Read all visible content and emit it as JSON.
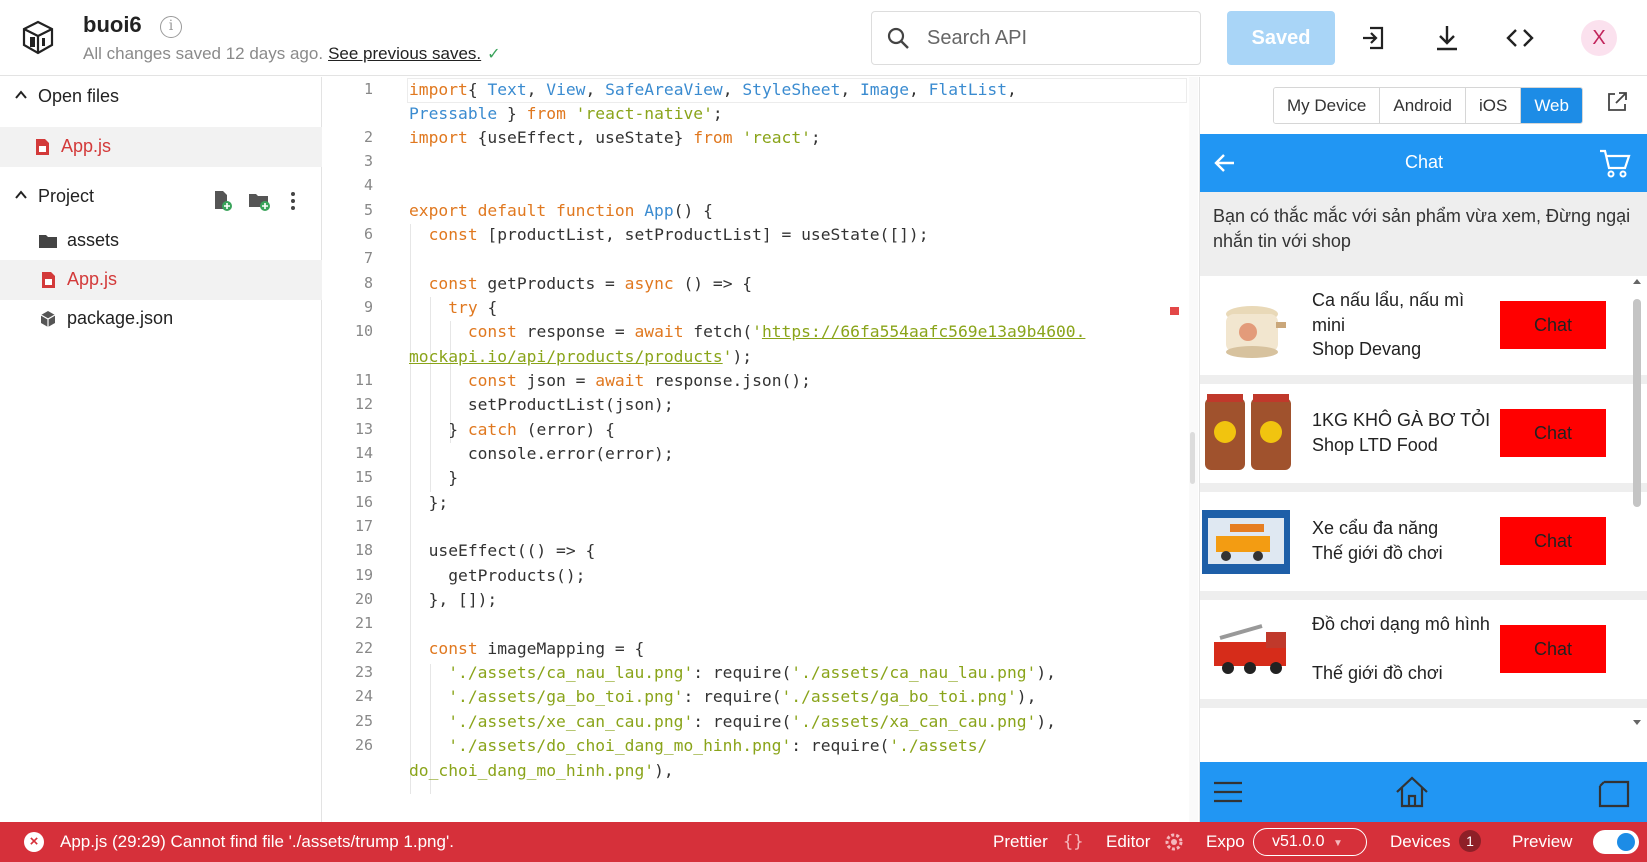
{
  "header": {
    "project_name": "buoi6",
    "save_status": "All changes saved 12 days ago.",
    "see_previous": "See previous saves.",
    "search_placeholder": "Search API",
    "saved_label": "Saved",
    "avatar_letter": "X"
  },
  "sidebar": {
    "open_files_label": "Open files",
    "open_file": "App.js",
    "project_label": "Project",
    "items": [
      {
        "label": "assets",
        "icon": "folder-icon"
      },
      {
        "label": "App.js",
        "icon": "js-file-icon"
      },
      {
        "label": "package.json",
        "icon": "package-icon"
      }
    ]
  },
  "editor": {
    "line_numbers": [
      "1",
      "2",
      "3",
      "4",
      "5",
      "6",
      "7",
      "8",
      "9",
      "10",
      "11",
      "12",
      "13",
      "14",
      "15",
      "16",
      "17",
      "18",
      "19",
      "20",
      "21",
      "22",
      "23",
      "24",
      "25",
      "26"
    ]
  },
  "preview": {
    "device_tabs": [
      "My Device",
      "Android",
      "iOS",
      "Web"
    ],
    "active_tab": "Web",
    "app": {
      "title": "Chat",
      "notice": "Bạn có thắc mắc với sản phẩm vừa xem, Đừng ngại nhắn tin với shop",
      "chat_label": "Chat",
      "products": [
        {
          "name": "Ca nấu lẩu, nấu mì mini",
          "shop": "Shop Devang"
        },
        {
          "name": "1KG KHÔ GÀ BƠ TỎI",
          "shop": "Shop LTD Food"
        },
        {
          "name": "Xe cẩu đa năng",
          "shop": "Thế giới đồ chơi"
        },
        {
          "name": "Đồ chơi dạng mô hình",
          "shop": "Thế giới đồ chơi"
        }
      ]
    }
  },
  "statusbar": {
    "error": "App.js (29:29) Cannot find file './assets/trump 1.png'.",
    "prettier": "Prettier",
    "editor": "Editor",
    "expo": "Expo",
    "version": "v51.0.0",
    "devices": "Devices",
    "devices_count": "1",
    "preview": "Preview"
  },
  "colors": {
    "accent": "#1d8ce6",
    "app_header": "#2196f3",
    "chat_button": "#ff0000",
    "status_error": "#d6303a"
  }
}
